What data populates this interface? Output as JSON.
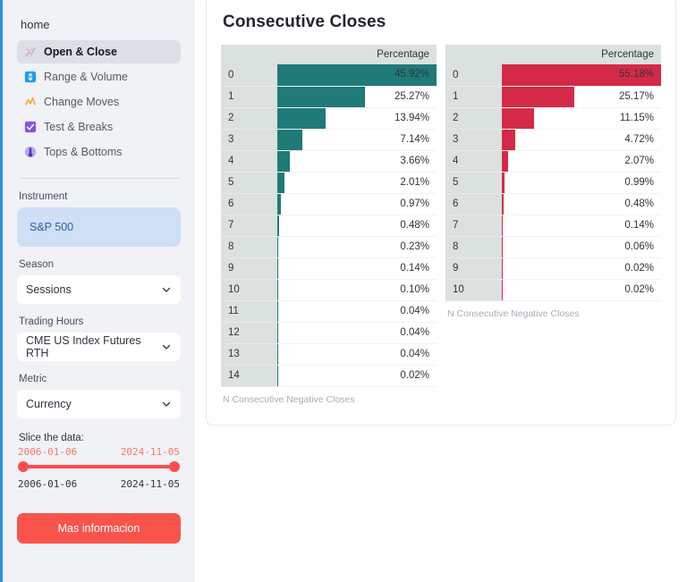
{
  "sidebar": {
    "home_label": "home",
    "nav_items": [
      {
        "label": "Open & Close",
        "icon": "line-chart-icon",
        "active": true
      },
      {
        "label": "Range & Volume",
        "icon": "updown-arrows-icon",
        "active": false
      },
      {
        "label": "Change Moves",
        "icon": "zigzag-icon",
        "active": false
      },
      {
        "label": "Test & Breaks",
        "icon": "checkbox-icon",
        "active": false
      },
      {
        "label": "Tops & Bottoms",
        "icon": "thermometer-icon",
        "active": false
      }
    ],
    "instrument": {
      "label": "Instrument",
      "value": "S&P 500"
    },
    "season": {
      "label": "Season",
      "value": "Sessions",
      "icon": "chevron-down-icon"
    },
    "trading_hours": {
      "label": "Trading Hours",
      "value": "CME US Index Futures RTH",
      "icon": "chevron-down-icon"
    },
    "metric": {
      "label": "Metric",
      "value": "Currency",
      "icon": "chevron-down-icon"
    },
    "slider": {
      "label": "Slice the data:",
      "start_handle": "2006-01-06",
      "end_handle": "2024-11-05",
      "start_value": "2006-01-06",
      "end_value": "2024-11-05"
    },
    "info_button": "Mas informacion",
    "accent_blue": "#2c8fe0",
    "accent_red": "#ff4b4b"
  },
  "main": {
    "card_title": "Consecutive Closes",
    "column_header": "Percentage",
    "left_caption": "N Consecutive Negative Closes",
    "right_caption": "N Consecutive Negative Closes",
    "teal": "#1f7a78",
    "crimson": "#d42a48"
  },
  "chart_data": [
    {
      "type": "bar",
      "title": "Consecutive Closes",
      "subtitle": "N Consecutive Negative Closes",
      "xlabel": "N Consecutive Negative Closes",
      "ylabel": "Percentage",
      "orientation": "horizontal",
      "color": "#1f7a78",
      "categories": [
        "0",
        "1",
        "2",
        "3",
        "4",
        "5",
        "6",
        "7",
        "8",
        "9",
        "10",
        "11",
        "12",
        "13",
        "14"
      ],
      "values": [
        45.92,
        25.27,
        13.94,
        7.14,
        3.66,
        2.01,
        0.97,
        0.48,
        0.23,
        0.14,
        0.1,
        0.04,
        0.04,
        0.04,
        0.02
      ],
      "labels": [
        "45.92%",
        "25.27%",
        "13.94%",
        "7.14%",
        "3.66%",
        "2.01%",
        "0.97%",
        "0.48%",
        "0.23%",
        "0.14%",
        "0.10%",
        "0.04%",
        "0.04%",
        "0.04%",
        "0.02%"
      ],
      "xlim": [
        0,
        45.92
      ],
      "grid": false,
      "legend": false
    },
    {
      "type": "bar",
      "title": "Consecutive Closes",
      "subtitle": "N Consecutive Negative Closes",
      "xlabel": "N Consecutive Negative Closes",
      "ylabel": "Percentage",
      "orientation": "horizontal",
      "color": "#d42a48",
      "categories": [
        "0",
        "1",
        "2",
        "3",
        "4",
        "5",
        "6",
        "7",
        "8",
        "9",
        "10"
      ],
      "values": [
        55.18,
        25.17,
        11.15,
        4.72,
        2.07,
        0.99,
        0.48,
        0.14,
        0.06,
        0.02,
        0.02
      ],
      "labels": [
        "55.18%",
        "25.17%",
        "11.15%",
        "4.72%",
        "2.07%",
        "0.99%",
        "0.48%",
        "0.14%",
        "0.06%",
        "0.02%",
        "0.02%"
      ],
      "xlim": [
        0,
        55.18
      ],
      "grid": false,
      "legend": false
    }
  ]
}
